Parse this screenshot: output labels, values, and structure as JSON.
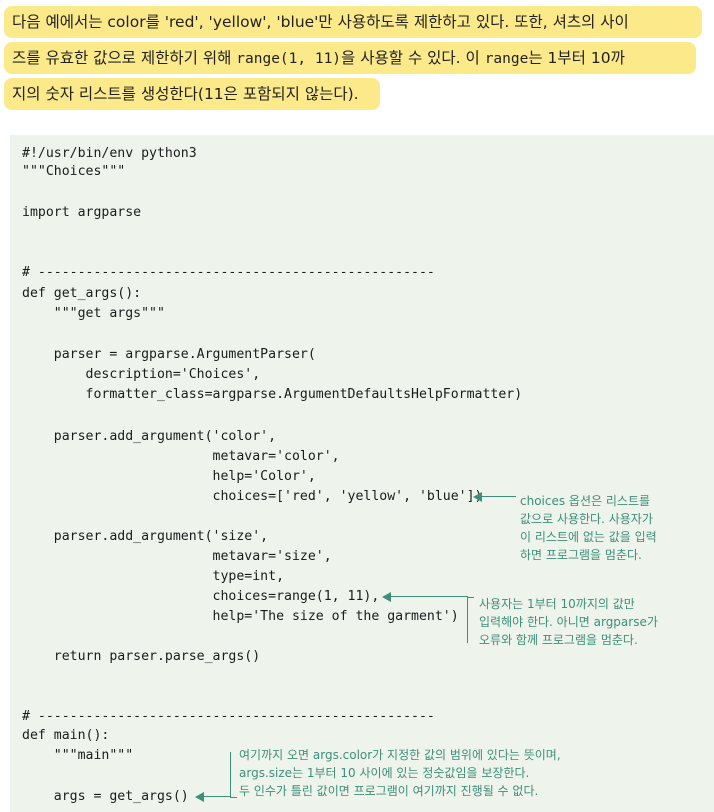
{
  "intro": {
    "line1": "다음 예에서는 color를 'red', 'yellow', 'blue'만 사용하도록 제한하고 있다. 또한, 셔츠의 사이",
    "line2_a": "즈를 유효한 값으로 제한하기 위해 ",
    "line2_code1": "range(1, 11)",
    "line2_b": "을 사용할 수 있다. 이 ",
    "line2_code2": "range",
    "line2_c": "는 1부터 10까",
    "line3": "지의 숫자 리스트를 생성한다(11은 포함되지 않는다)."
  },
  "code": {
    "l01": "#!/usr/bin/env python3",
    "l02": "\"\"\"Choices\"\"\"",
    "l03": "import argparse",
    "l04": "# --------------------------------------------------",
    "l05": "def get_args():",
    "l06": "    \"\"\"get args\"\"\"",
    "l07": "    parser = argparse.ArgumentParser(",
    "l08": "        description='Choices',",
    "l09": "        formatter_class=argparse.ArgumentDefaultsHelpFormatter)",
    "l10": "    parser.add_argument('color',",
    "l11": "                        metavar='color',",
    "l12": "                        help='Color',",
    "l13": "                        choices=['red', 'yellow', 'blue'])",
    "l14": "    parser.add_argument('size',",
    "l15": "                        metavar='size',",
    "l16": "                        type=int,",
    "l17": "                        choices=range(1, 11),",
    "l18": "                        help='The size of the garment')",
    "l19": "    return parser.parse_args()",
    "l20": "# --------------------------------------------------",
    "l21": "def main():",
    "l22": "    \"\"\"main\"\"\"",
    "l23": "    args = get_args()"
  },
  "callouts": {
    "choices": [
      "choices 옵션은 리스트를",
      "값으로 사용한다. 사용자가",
      "이 리스트에 없는 값을 입력",
      "하면 프로그램을 멈춘다."
    ],
    "range": [
      "사용자는 1부터 10까지의 값만",
      "입력해야 한다. 아니면 argparse가",
      "오류와 함께 프로그램을 멈춘다."
    ],
    "main": [
      "여기까지 오면 args.color가 지정한 값의 범위에 있다는 뜻이며,",
      "args.size는 1부터 10 사이에 있는 정숫값임을 보장한다.",
      "두 인수가 틀린 값이면 프로그램이 여기까지 진행될 수 없다."
    ]
  },
  "colors": {
    "highlight": "#fbe98a",
    "code_bg": "#eef3ec",
    "callout": "#3d8f7a"
  }
}
